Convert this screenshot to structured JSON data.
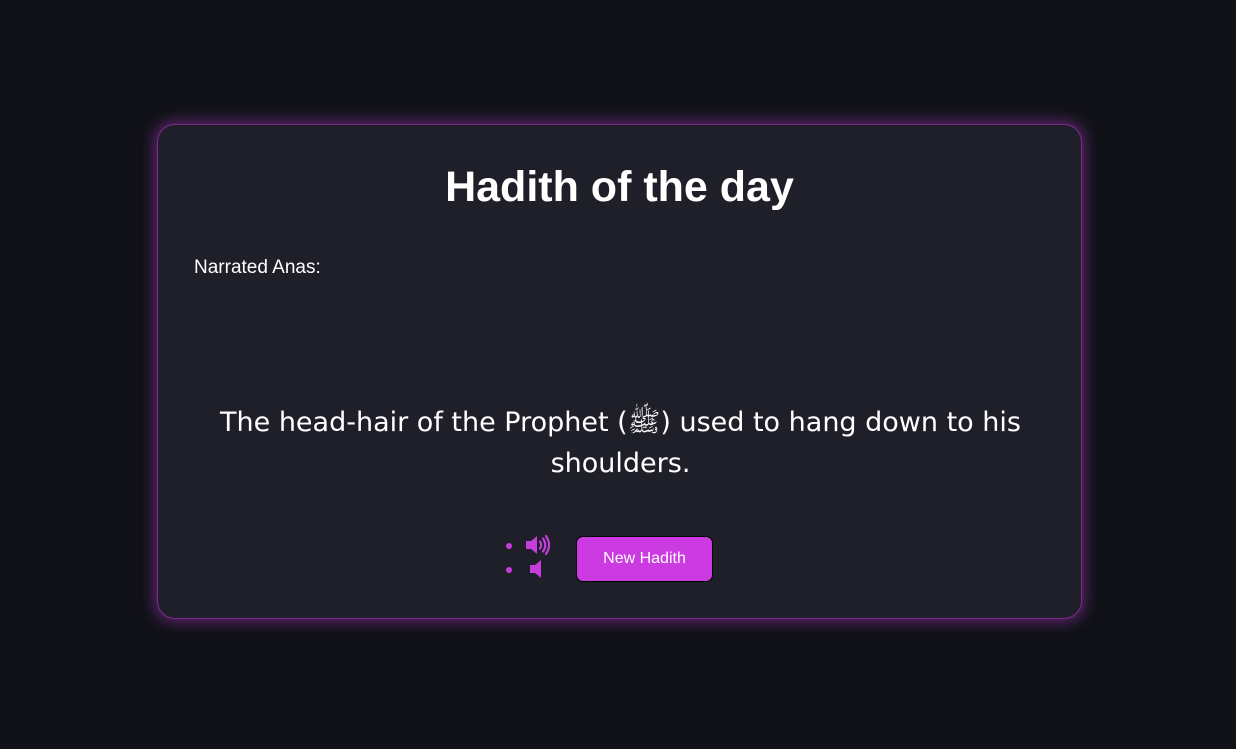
{
  "card": {
    "title": "Hadith of the day",
    "narrator": "Narrated Anas:",
    "hadith_text": "The head-hair of the Prophet (ﷺ) used to hang down to his shoulders."
  },
  "controls": {
    "audio_on_icon": "volume-on-icon",
    "audio_off_icon": "volume-off-icon",
    "new_hadith_label": "New Hadith"
  },
  "colors": {
    "background": "#101217",
    "card": "#1e1f28",
    "accent": "#cc3ae2",
    "glow": "#be3cdc",
    "text": "#ffffff"
  }
}
